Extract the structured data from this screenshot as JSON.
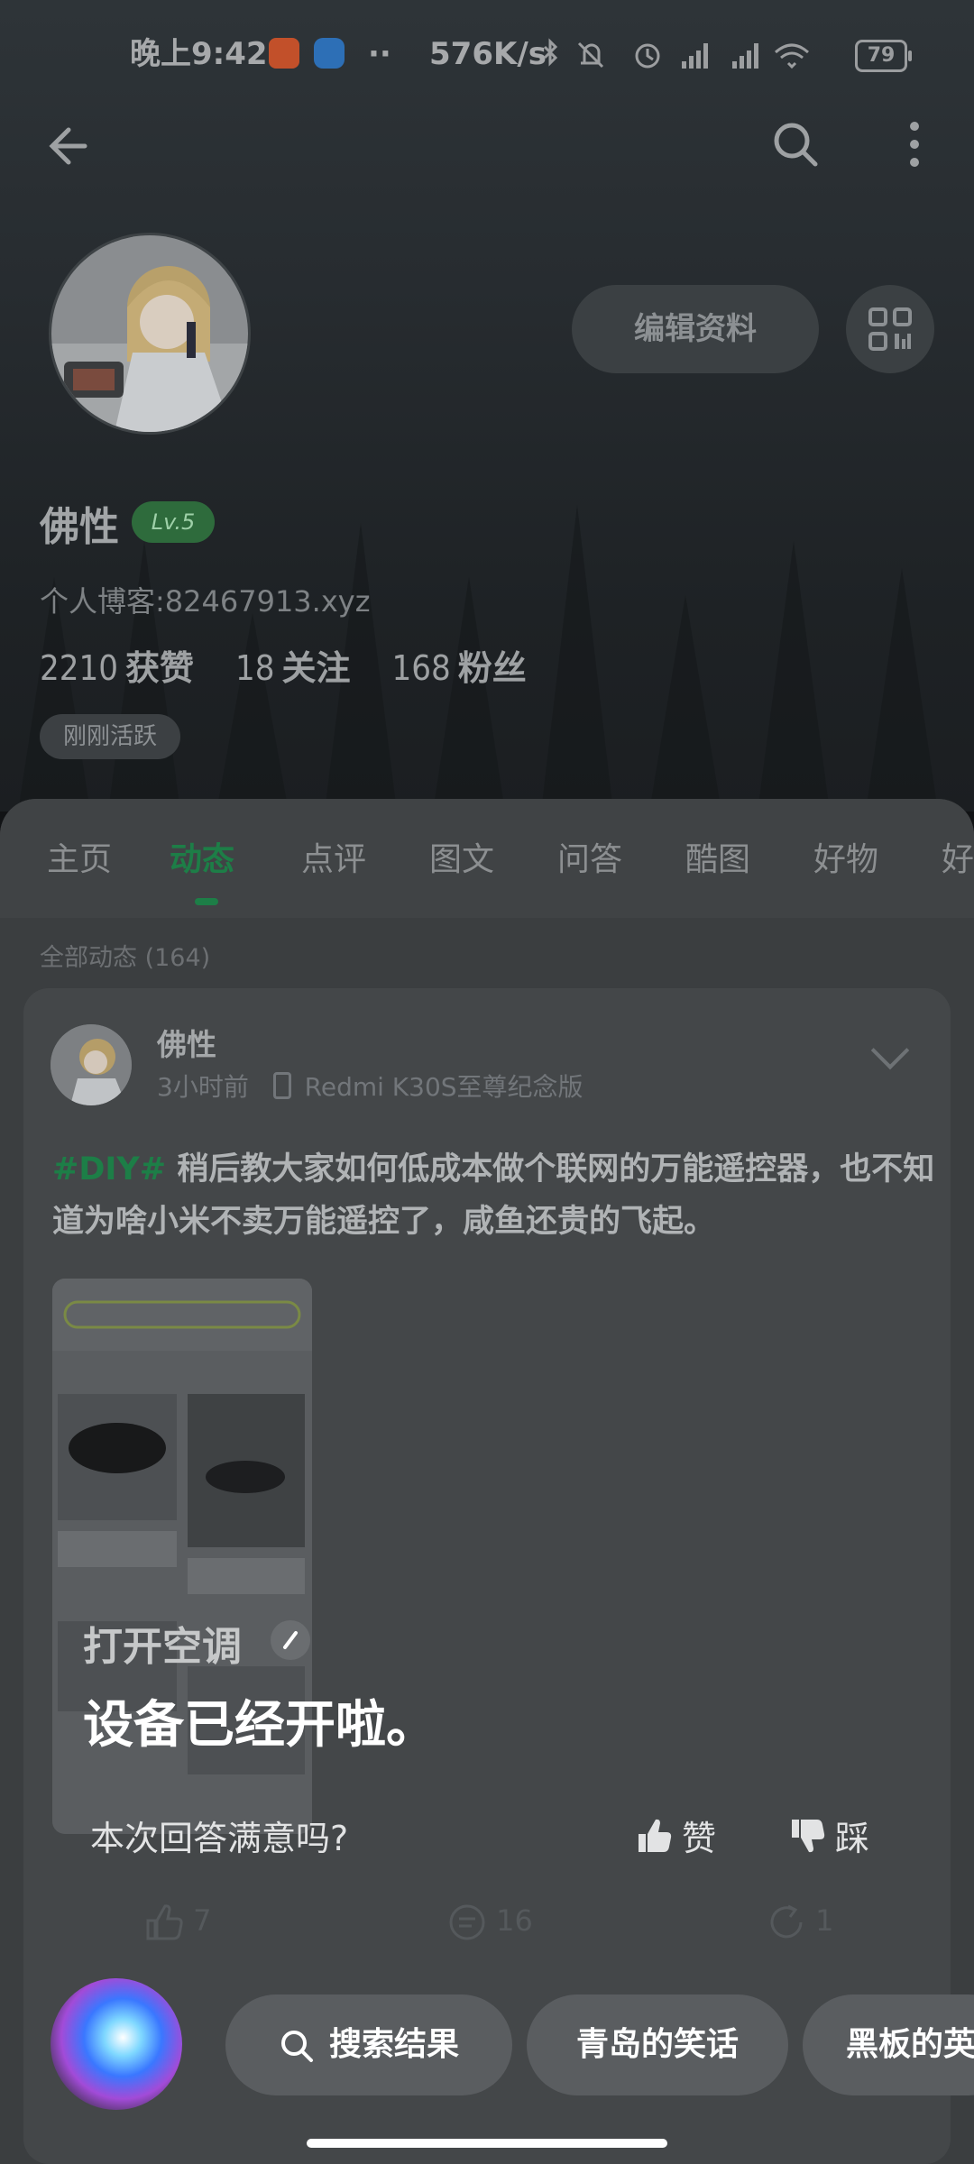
{
  "status_bar": {
    "time": "晚上9:42",
    "dots": "··",
    "speed": "576K/s",
    "battery": "79"
  },
  "header": {
    "back_icon": "arrow-left-icon",
    "search_icon": "search-icon",
    "more_icon": "more-vertical-icon"
  },
  "profile": {
    "name": "佛性",
    "level": "Lv.5",
    "blog": "个人博客:82467913.xyz",
    "stats": [
      {
        "num": "2210",
        "label": "获赞"
      },
      {
        "num": "18",
        "label": "关注"
      },
      {
        "num": "168",
        "label": "粉丝"
      }
    ],
    "active": "刚刚活跃",
    "edit_button": "编辑资料"
  },
  "tabs": [
    "主页",
    "动态",
    "点评",
    "图文",
    "问答",
    "酷图",
    "好物",
    "好"
  ],
  "feed": {
    "all_label": "全部动态 (164)",
    "post": {
      "author": "佛性",
      "time": "3小时前",
      "device": "Redmi K30S至尊纪念版",
      "hashtag": "#DIY#",
      "text": " 稍后教大家如何低成本做个联网的万能遥控器，也不知道为啥小米不卖万能遥控了，咸鱼还贵的飞起。",
      "likes": "7",
      "comments": "16",
      "shares": "1"
    }
  },
  "assistant": {
    "query": "打开空调",
    "answer": "设备已经开啦。",
    "feedback_question": "本次回答满意吗?",
    "like": "赞",
    "dislike": "踩",
    "suggestions": [
      "搜索结果",
      "青岛的笑话",
      "黑板的英"
    ]
  }
}
